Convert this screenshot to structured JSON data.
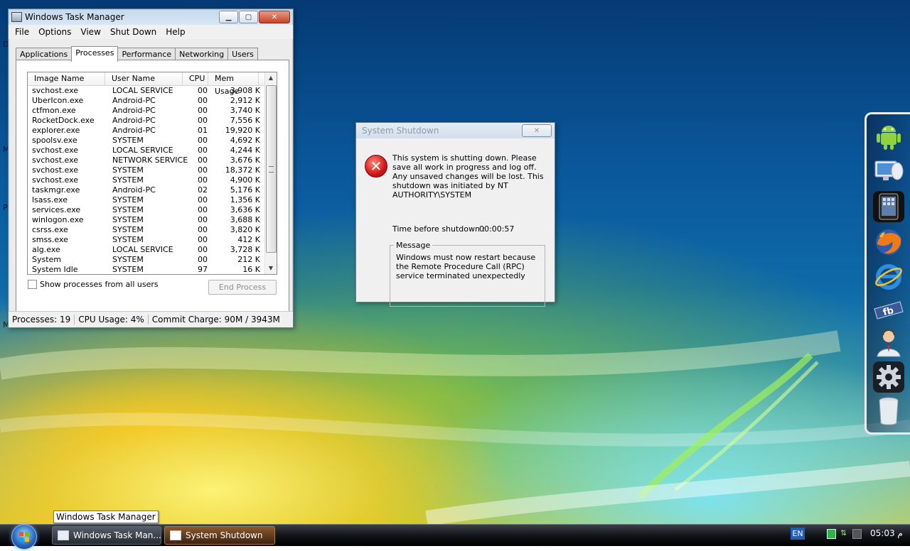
{
  "taskmgr": {
    "title": "Windows Task Manager",
    "menu": [
      "File",
      "Options",
      "View",
      "Shut Down",
      "Help"
    ],
    "tabs": [
      "Applications",
      "Processes",
      "Performance",
      "Networking",
      "Users"
    ],
    "selected_tab": "Processes",
    "columns": [
      "Image Name",
      "User Name",
      "CPU",
      "Mem Usage"
    ],
    "rows": [
      [
        "svchost.exe",
        "LOCAL SERVICE",
        "00",
        "3,908 K"
      ],
      [
        "UberIcon.exe",
        "Android-PC",
        "00",
        "2,912 K"
      ],
      [
        "ctfmon.exe",
        "Android-PC",
        "00",
        "3,740 K"
      ],
      [
        "RocketDock.exe",
        "Android-PC",
        "00",
        "7,556 K"
      ],
      [
        "explorer.exe",
        "Android-PC",
        "01",
        "19,920 K"
      ],
      [
        "spoolsv.exe",
        "SYSTEM",
        "00",
        "4,692 K"
      ],
      [
        "svchost.exe",
        "LOCAL SERVICE",
        "00",
        "4,244 K"
      ],
      [
        "svchost.exe",
        "NETWORK SERVICE",
        "00",
        "3,676 K"
      ],
      [
        "svchost.exe",
        "SYSTEM",
        "00",
        "18,372 K"
      ],
      [
        "svchost.exe",
        "SYSTEM",
        "00",
        "4,900 K"
      ],
      [
        "taskmgr.exe",
        "Android-PC",
        "02",
        "5,176 K"
      ],
      [
        "lsass.exe",
        "SYSTEM",
        "00",
        "1,356 K"
      ],
      [
        "services.exe",
        "SYSTEM",
        "00",
        "3,636 K"
      ],
      [
        "winlogon.exe",
        "SYSTEM",
        "00",
        "3,688 K"
      ],
      [
        "csrss.exe",
        "SYSTEM",
        "00",
        "3,820 K"
      ],
      [
        "smss.exe",
        "SYSTEM",
        "00",
        "412 K"
      ],
      [
        "alg.exe",
        "LOCAL SERVICE",
        "00",
        "3,728 K"
      ],
      [
        "System",
        "SYSTEM",
        "00",
        "212 K"
      ],
      [
        "System Idle Process",
        "SYSTEM",
        "97",
        "16 K"
      ]
    ],
    "show_all_label": "Show processes from all users",
    "end_process_label": "End Process",
    "status": {
      "processes": "Processes: 19",
      "cpu": "CPU Usage: 4%",
      "commit": "Commit Charge: 90M / 3943M"
    }
  },
  "shutdown": {
    "title": "System Shutdown",
    "message": "This system is shutting down. Please save all work in progress and log off. Any unsaved changes will be lost. This shutdown was initiated by NT AUTHORITY\\SYSTEM",
    "time_label": "Time before shutdown :",
    "time_value": "00:00:57",
    "group_label": "Message",
    "group_text": "Windows must now restart because the Remote Procedure Call (RPC) service terminated unexpectedly"
  },
  "taskbar": {
    "tooltip": "Windows Task Manager",
    "buttons": [
      "Windows Task Man...",
      "System Shutdown"
    ],
    "language": "EN",
    "clock": "05:03  م"
  },
  "dock": {
    "items": [
      "android-icon",
      "computer-icon",
      "tablet-icon",
      "firefox-icon",
      "internet-explorer-icon",
      "facebook-icon",
      "user-support-icon",
      "settings-gear-icon",
      "trash-icon"
    ]
  },
  "desktop_fragments": [
    "D",
    "M",
    "P",
    "M"
  ],
  "colors": {
    "close_button": "#c64426",
    "error_icon": "#d11616",
    "shutdown_taskbar": "#8a5a2e"
  }
}
